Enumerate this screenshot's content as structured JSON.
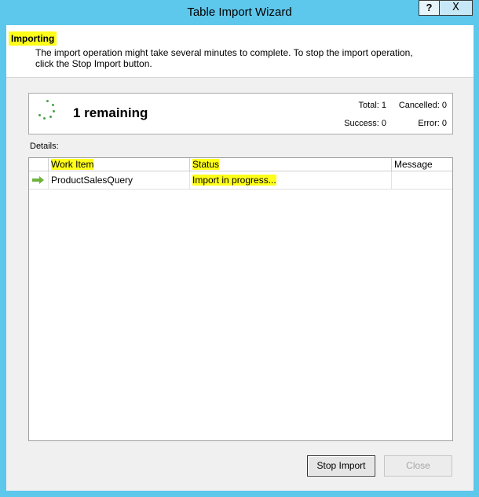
{
  "window": {
    "title": "Table Import Wizard",
    "help_label": "?",
    "close_label": "X"
  },
  "header": {
    "title": "Importing",
    "description_line1": "The import operation might take several minutes to complete. To stop the import operation,",
    "description_line2": "click the Stop Import button."
  },
  "status": {
    "remaining_text": "1 remaining",
    "total_label": "Total: 1",
    "cancelled_label": "Cancelled: 0",
    "success_label": "Success: 0",
    "error_label": "Error: 0"
  },
  "details": {
    "label": "Details:",
    "columns": [
      "Work Item",
      "Status",
      "Message"
    ],
    "rows": [
      {
        "work_item": "ProductSalesQuery",
        "status": "Import in progress...",
        "message": ""
      }
    ]
  },
  "buttons": {
    "stop_import": "Stop Import",
    "close": "Close"
  },
  "colors": {
    "titlebar": "#5ec7ec",
    "highlight": "#ffff1a",
    "arrow": "#6fb33c"
  }
}
